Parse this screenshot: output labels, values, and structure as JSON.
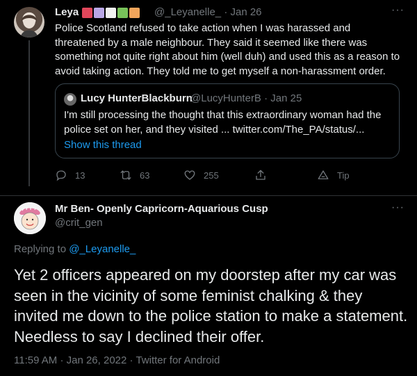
{
  "parent_tweet": {
    "name": "Leya",
    "emoji_colors": [
      "#e0475b",
      "#b9a7e6",
      "#f1f1f1",
      "#78c25a",
      "#f2a55b"
    ],
    "handle": "@_Leyanelle_",
    "separator": "·",
    "date": "Jan 26",
    "more": "···",
    "text": "Police Scotland refused to take action when I was harassed and threatened by a male neighbour. They said it seemed like there was something not quite right about him (well duh) and used this as a reason to avoid taking action. They told me to get myself a non-harassment order.",
    "quote": {
      "name": "Lucy HunterBlackburn",
      "handle": "@LucyHunterB",
      "separator": "·",
      "date": "Jan 25",
      "text": "I'm still processing the thought that this extraordinary woman had the police set on her, and they visited ... twitter.com/The_PA/status/...",
      "show_thread": "Show this thread"
    },
    "actions": {
      "replies": "13",
      "retweets": "63",
      "likes": "255",
      "share_icon": "share-icon",
      "tip": "Tip"
    }
  },
  "reply_tweet": {
    "name": "Mr Ben- Openly Capricorn-Aquarious Cusp",
    "handle": "@crit_gen",
    "more": "···",
    "replying_prefix": "Replying to ",
    "replying_to": "@_Leyanelle_",
    "text": "Yet 2 officers appeared on my doorstep after my car was seen in the vicinity of some feminist chalking & they invited me down to the police station to make a statement. Needless to say I declined their offer.",
    "time": "11:59 AM",
    "separator": "·",
    "date": "Jan 26, 2022",
    "separator2": "·",
    "client": "Twitter for Android"
  },
  "colors": {
    "background": "#000000",
    "text": "#e7e9ea",
    "muted": "#71767b",
    "link": "#1d9bf0",
    "border": "#2f3336"
  }
}
